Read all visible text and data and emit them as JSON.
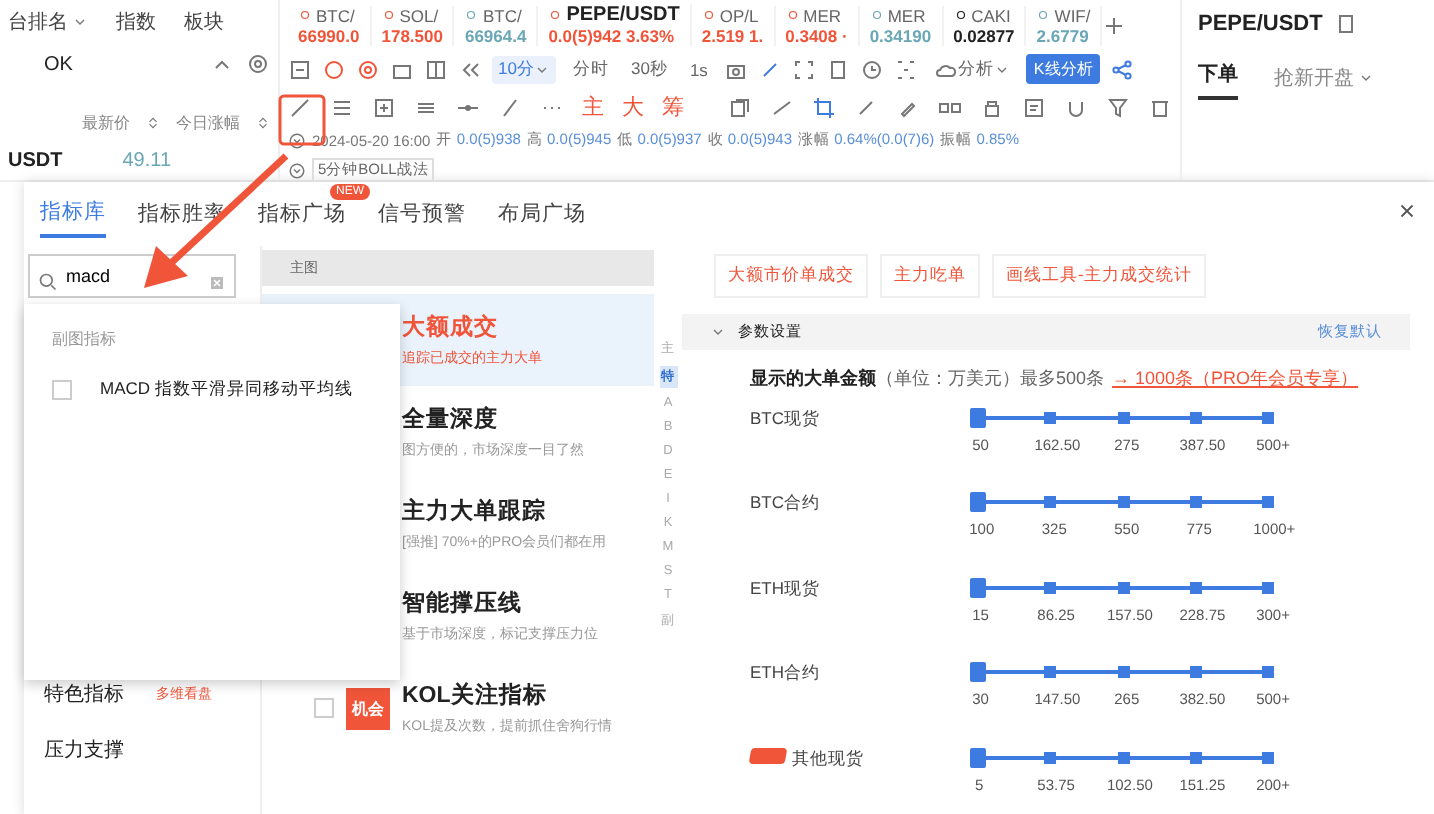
{
  "market_panel": {
    "tabs": [
      {
        "label": "台排名",
        "dropdown": true
      },
      {
        "label": "指数",
        "dropdown": false
      },
      {
        "label": "板块",
        "dropdown": false
      }
    ],
    "filter_value": "OK",
    "columns": [
      "最新价",
      "今日涨幅"
    ],
    "rows": [
      {
        "symbol": "USDT",
        "price": "49.11"
      }
    ]
  },
  "tickers": [
    {
      "symbol": "BTC/",
      "price": "66990.0",
      "color": "#f0553a",
      "selected": false
    },
    {
      "symbol": "SOL/",
      "price": "178.500",
      "color": "#f0553a",
      "selected": false
    },
    {
      "symbol": "BTC/",
      "price": "66964.4",
      "color": "#6aa7b5",
      "selected": false
    },
    {
      "symbol": "PEPE/USDT",
      "price": "0.0(5)942",
      "change": "3.63%",
      "color": "#f0553a",
      "selected": true
    },
    {
      "symbol": "OP/L",
      "price": "2.519 1.",
      "color": "#f0553a",
      "selected": false
    },
    {
      "symbol": "MER",
      "price": "0.3408 ·",
      "color": "#f0553a",
      "selected": false
    },
    {
      "symbol": "MER",
      "price": "0.34190",
      "color": "#6aa7b5",
      "selected": false
    },
    {
      "symbol": "CAKI",
      "price": "0.02877",
      "color": "#222222",
      "selected": false
    },
    {
      "symbol": "WIF/",
      "price": "2.6779",
      "color": "#6aa7b5",
      "selected": false
    }
  ],
  "toolbar": {
    "intervals": [
      {
        "label": "10分",
        "selected": true
      },
      {
        "label": "分时",
        "selected": false
      },
      {
        "label": "30秒",
        "selected": false
      },
      {
        "label": "1s",
        "selected": false
      }
    ],
    "analysis_menu": "分析",
    "kline_button": "K线分析",
    "quick_marks": [
      "主",
      "大",
      "筹"
    ]
  },
  "bar_info": {
    "date": "2024-05-20 16:00",
    "values": [
      {
        "label": "开",
        "value": "0.0(5)938"
      },
      {
        "label": "高",
        "value": "0.0(5)945"
      },
      {
        "label": "低",
        "value": "0.0(5)937"
      },
      {
        "label": "收",
        "value": "0.0(5)943"
      },
      {
        "label": "涨幅",
        "value": "0.64%(0.0(7)6)"
      },
      {
        "label": "振幅",
        "value": "0.85%"
      }
    ],
    "strategy": "5分钟BOLL战法"
  },
  "order_panel": {
    "title": "PEPE/USDT",
    "tabs": [
      {
        "label": "下单",
        "selected": true,
        "dropdown": false
      },
      {
        "label": "抢新开盘",
        "selected": false,
        "dropdown": true
      }
    ]
  },
  "dialog": {
    "tabs": [
      {
        "label": "指标库",
        "selected": true
      },
      {
        "label": "指标胜率",
        "selected": false
      },
      {
        "label": "指标广场",
        "selected": false,
        "badge": "NEW"
      },
      {
        "label": "信号预警",
        "selected": false
      },
      {
        "label": "布局广场",
        "selected": false
      }
    ],
    "search": {
      "value": "macd"
    },
    "search_results": {
      "section": "副图指标",
      "items": [
        {
          "label": "MACD 指数平滑异同移动平均线",
          "checked": false
        }
      ]
    },
    "categories": [
      {
        "label": "特色指标",
        "note": "多维看盘"
      },
      {
        "label": "压力支撑"
      }
    ],
    "indicator_list": {
      "section": "主图",
      "items": [
        {
          "title": "大额成交",
          "subtitle": "追踪已成交的主力大单",
          "selected": true
        },
        {
          "title": "全量深度",
          "subtitle": "图方便的，市场深度一目了然",
          "selected": false
        },
        {
          "title": "主力大单跟踪",
          "subtitle": "[强推] 70%+的PRO会员们都在用",
          "selected": false
        },
        {
          "title": "智能撑压线",
          "subtitle": "基于市场深度，标记支撑压力位",
          "selected": false
        },
        {
          "title": "KOL关注指标",
          "subtitle": "KOL提及次数，提前抓住舍狗行情",
          "selected": false,
          "checked": false,
          "tag": "机会"
        }
      ]
    },
    "index_letters": [
      {
        "label": "主",
        "selected": false
      },
      {
        "label": "特",
        "selected": true
      },
      {
        "label": "A",
        "selected": false
      },
      {
        "label": "B",
        "selected": false
      },
      {
        "label": "D",
        "selected": false
      },
      {
        "label": "E",
        "selected": false
      },
      {
        "label": "I",
        "selected": false
      },
      {
        "label": "K",
        "selected": false
      },
      {
        "label": "M",
        "selected": false
      },
      {
        "label": "S",
        "selected": false
      },
      {
        "label": "T",
        "selected": false
      },
      {
        "label": "副",
        "selected": false
      }
    ],
    "detail": {
      "related": [
        "大额市价单成交",
        "主力吃单",
        "画线工具-主力成交统计"
      ],
      "section": {
        "title": "参数设置",
        "expanded": true,
        "reset": "恢复默认"
      },
      "heading": {
        "title": "显示的大单金额",
        "note": "（单位：万美元）最多500条",
        "link": "→ 1000条（PRO年会员专享）"
      },
      "sliders": [
        {
          "label": "BTC现货",
          "level": 0,
          "tagged": false,
          "ticks": [
            "50",
            "162.50",
            "275",
            "387.50",
            "500+"
          ]
        },
        {
          "label": "BTC合约",
          "level": 0,
          "tagged": false,
          "ticks": [
            "100",
            "325",
            "550",
            "775",
            "1000+"
          ]
        },
        {
          "label": "ETH现货",
          "level": 0,
          "tagged": false,
          "ticks": [
            "15",
            "86.25",
            "157.50",
            "228.75",
            "300+"
          ]
        },
        {
          "label": "ETH合约",
          "level": 0,
          "tagged": false,
          "ticks": [
            "30",
            "147.50",
            "265",
            "382.50",
            "500+"
          ]
        },
        {
          "label": "其他现货",
          "level": 0,
          "tagged": true,
          "ticks": [
            "5",
            "53.75",
            "102.50",
            "151.25",
            "200+"
          ]
        }
      ]
    }
  }
}
